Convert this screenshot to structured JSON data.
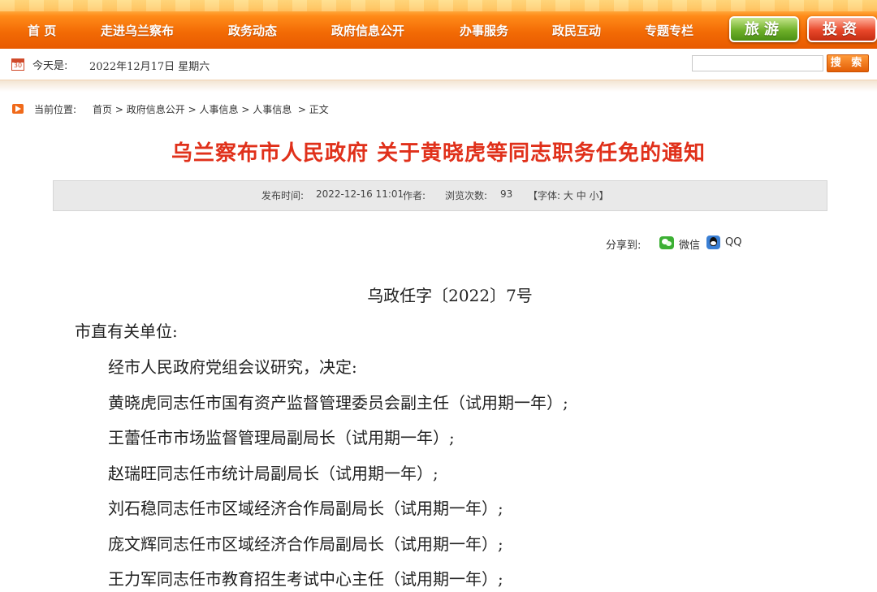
{
  "nav": {
    "items": [
      "首 页",
      "走进乌兰察布",
      "政务动态",
      "政府信息公开",
      "办事服务",
      "政民互动",
      "专题专栏"
    ],
    "tourism_button": "旅游",
    "invest_button": "投资"
  },
  "datebar": {
    "today_label": "今天是:",
    "date": "2022年12月17日 星期六",
    "calendar_number": "30",
    "search_placeholder": "",
    "search_button": "搜 索"
  },
  "breadcrumb": {
    "label": "当前位置:",
    "items": [
      "首页",
      "政府信息公开",
      "人事信息",
      "人事信息",
      "正文"
    ],
    "separator": ">"
  },
  "article": {
    "title": "乌兰察布市人民政府 关于黄晓虎等同志职务任免的通知",
    "meta": {
      "publish_label": "发布时间:",
      "publish_time": "2022-12-16 11:01",
      "author_label": "作者:",
      "author": "",
      "views_label": "浏览次数:",
      "views": "93",
      "font_label": "【字体:",
      "font_large": "大",
      "font_medium": "中",
      "font_small": "小",
      "font_close": "】"
    },
    "share": {
      "label": "分享到:",
      "wechat": "微信",
      "qq": "QQ"
    },
    "doc_number": "乌政任字〔2022〕7号",
    "salutation": "市直有关单位:",
    "paragraphs": [
      "经市人民政府党组会议研究，决定:",
      "黄晓虎同志任市国有资产监督管理委员会副主任（试用期一年）;",
      "王蕾任市市场监督管理局副局长（试用期一年）;",
      "赵瑞旺同志任市统计局副局长（试用期一年）;",
      "刘石稳同志任市区域经济合作局副局长（试用期一年）;",
      "庞文辉同志任市区域经济合作局副局长（试用期一年）;",
      "王力军同志任市教育招生考试中心主任（试用期一年）;"
    ]
  },
  "colors": {
    "nav_orange": "#e85a00",
    "title_red": "#e0301a",
    "meta_bg": "#e9e9e9"
  }
}
